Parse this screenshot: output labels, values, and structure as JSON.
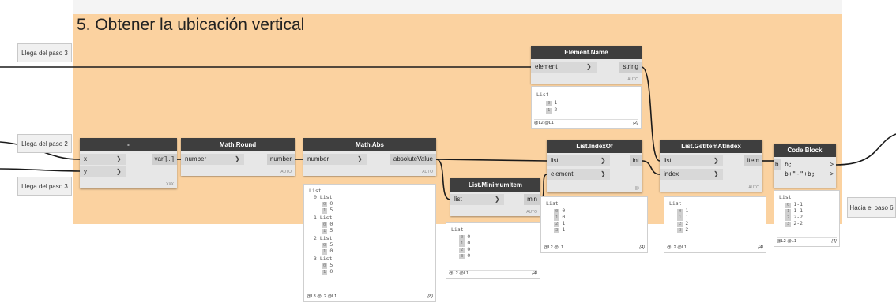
{
  "group": {
    "title": "5. Obtener la ubicación vertical"
  },
  "notes": {
    "paso3_top": "Llega del paso 3",
    "paso2": "Llega del paso 2",
    "paso3_bottom": "Llega del paso 3",
    "paso6": "Hacia el paso 6"
  },
  "nodes": {
    "point": {
      "title": "-",
      "in1": "x",
      "in2": "y",
      "out": "var[]..[]",
      "lacing": "XXX"
    },
    "round": {
      "title": "Math.Round",
      "in": "number",
      "out": "number",
      "lacing": "AUTO"
    },
    "abs": {
      "title": "Math.Abs",
      "in": "number",
      "out": "absoluteValue",
      "lacing": "AUTO"
    },
    "minitem": {
      "title": "List.MinimumItem",
      "in": "list",
      "out": "min",
      "lacing": "AUTO"
    },
    "indexof": {
      "title": "List.IndexOf",
      "in1": "list",
      "in2": "element",
      "out": "int",
      "lacing": "|||\\"
    },
    "elemname": {
      "title": "Element.Name",
      "in": "element",
      "out": "string",
      "lacing": "AUTO"
    },
    "getitem": {
      "title": "List.GetItemAtIndex",
      "in1": "list",
      "in2": "index",
      "out": "item",
      "lacing": "AUTO"
    },
    "codeblock": {
      "title": "Code Block",
      "line1": "b;",
      "line2": "b+\"-\"+b;",
      "in": "b",
      "out1": ">",
      "out2": ">"
    }
  },
  "previews": {
    "elemname": {
      "head": "List",
      "rows": [
        {
          "i": "0",
          "v": "1"
        },
        {
          "i": "1",
          "v": "2"
        }
      ],
      "foot": "@L2 @L1",
      "count": "{2}"
    },
    "abs": {
      "head": "List",
      "groups": [
        {
          "label": "0 List",
          "rows": [
            {
              "i": "0",
              "v": "0"
            },
            {
              "i": "1",
              "v": "5"
            }
          ]
        },
        {
          "label": "1 List",
          "rows": [
            {
              "i": "0",
              "v": "0"
            },
            {
              "i": "1",
              "v": "5"
            }
          ]
        },
        {
          "label": "2 List",
          "rows": [
            {
              "i": "0",
              "v": "5"
            },
            {
              "i": "1",
              "v": "0"
            }
          ]
        },
        {
          "label": "3 List",
          "rows": [
            {
              "i": "0",
              "v": "5"
            },
            {
              "i": "1",
              "v": "0"
            }
          ]
        }
      ],
      "foot": "@L3 @L2 @L1",
      "count": "{8}"
    },
    "minitem": {
      "head": "List",
      "rows": [
        {
          "i": "0",
          "v": "0"
        },
        {
          "i": "1",
          "v": "0"
        },
        {
          "i": "2",
          "v": "0"
        },
        {
          "i": "3",
          "v": "0"
        }
      ],
      "foot": "@L2 @L1",
      "count": "{4}"
    },
    "indexof": {
      "head": "List",
      "rows": [
        {
          "i": "0",
          "v": "0"
        },
        {
          "i": "1",
          "v": "0"
        },
        {
          "i": "2",
          "v": "1"
        },
        {
          "i": "3",
          "v": "1"
        }
      ],
      "foot": "@L2 @L1",
      "count": "{4}"
    },
    "getitem": {
      "head": "List",
      "rows": [
        {
          "i": "0",
          "v": "1"
        },
        {
          "i": "1",
          "v": "1"
        },
        {
          "i": "2",
          "v": "2"
        },
        {
          "i": "3",
          "v": "2"
        }
      ],
      "foot": "@L2 @L1",
      "count": "{4}"
    },
    "codeblock": {
      "head": "List",
      "rows": [
        {
          "i": "0",
          "v": "1-1"
        },
        {
          "i": "1",
          "v": "1-1"
        },
        {
          "i": "2",
          "v": "2-2"
        },
        {
          "i": "3",
          "v": "2-2"
        }
      ],
      "foot": "@L2 @L1",
      "count": "{4}"
    }
  }
}
